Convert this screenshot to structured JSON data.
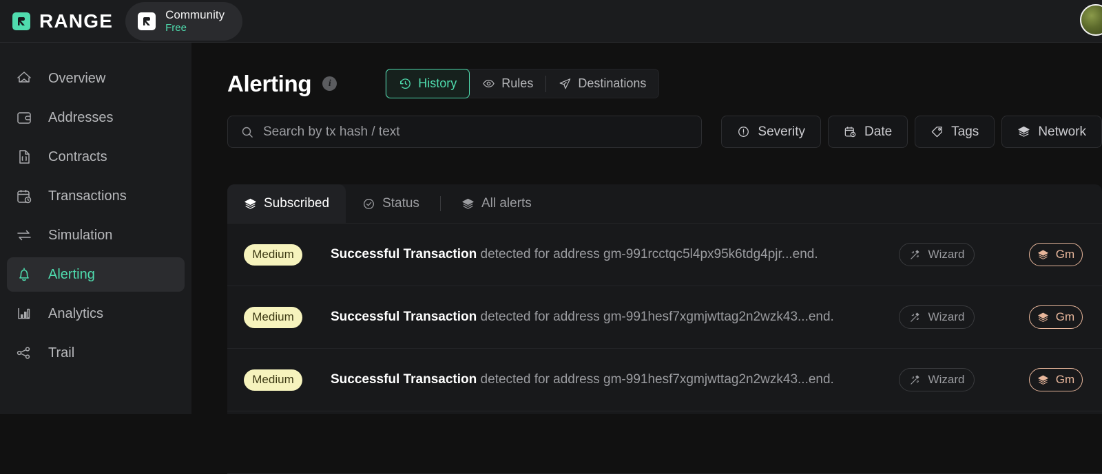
{
  "brand": {
    "name": "RANGE",
    "logo_icon": "range-logo-icon"
  },
  "plan": {
    "name": "Community",
    "tier": "Free",
    "icon": "range-badge-icon"
  },
  "account": {
    "avatar_icon": "user-avatar"
  },
  "sidebar": {
    "items": [
      {
        "label": "Overview",
        "icon": "home-icon",
        "active": false
      },
      {
        "label": "Addresses",
        "icon": "wallet-icon",
        "active": false
      },
      {
        "label": "Contracts",
        "icon": "file-code-icon",
        "active": false
      },
      {
        "label": "Transactions",
        "icon": "calendar-clock-icon",
        "active": false
      },
      {
        "label": "Simulation",
        "icon": "swap-arrows-icon",
        "active": false
      },
      {
        "label": "Alerting",
        "icon": "bell-icon",
        "active": true
      },
      {
        "label": "Analytics",
        "icon": "bar-chart-icon",
        "active": false
      },
      {
        "label": "Trail",
        "icon": "nodes-graph-icon",
        "active": false
      }
    ]
  },
  "page": {
    "title": "Alerting",
    "info_icon": "info-icon",
    "view_tabs": [
      {
        "label": "History",
        "icon": "history-clock-icon",
        "active": true
      },
      {
        "label": "Rules",
        "icon": "eye-icon",
        "active": false
      },
      {
        "label": "Destinations",
        "icon": "send-plane-icon",
        "active": false
      }
    ]
  },
  "search": {
    "placeholder": "Search by tx hash / text",
    "value": "",
    "icon": "search-icon"
  },
  "filters": [
    {
      "label": "Severity",
      "icon": "alert-circle-icon"
    },
    {
      "label": "Date",
      "icon": "calendar-clock-icon"
    },
    {
      "label": "Tags",
      "icon": "tag-icon"
    },
    {
      "label": "Network",
      "icon": "layers-icon"
    }
  ],
  "list_tabs": [
    {
      "label": "Subscribed",
      "icon": "layers-icon",
      "active": true
    },
    {
      "label": "Status",
      "icon": "check-circle-icon",
      "active": false
    },
    {
      "label": "All alerts",
      "icon": "layers-icon",
      "active": false
    }
  ],
  "alerts": [
    {
      "severity": "Medium",
      "title": "Successful Transaction",
      "detail": " detected for address gm-991rcctqc5l4px95k6tdg4pjr...end.",
      "source": "Wizard",
      "source_icon": "magic-wand-icon",
      "network": "Gm",
      "network_icon": "layers-icon"
    },
    {
      "severity": "Medium",
      "title": "Successful Transaction",
      "detail": " detected for address gm-991hesf7xgmjwttag2n2wzk43...end.",
      "source": "Wizard",
      "source_icon": "magic-wand-icon",
      "network": "Gm",
      "network_icon": "layers-icon"
    },
    {
      "severity": "Medium",
      "title": "Successful Transaction",
      "detail": " detected for address gm-991hesf7xgmjwttag2n2wzk43...end.",
      "source": "Wizard",
      "source_icon": "magic-wand-icon",
      "network": "Gm",
      "network_icon": "layers-icon"
    }
  ],
  "colors": {
    "accent": "#4fdcae",
    "severity_medium_bg": "#f6f3bd",
    "severity_medium_text": "#3d3a14",
    "network_badge": "#e7b69b",
    "app_bg": "#111111",
    "panel_bg": "#18191b",
    "sidebar_bg": "#1b1c1e"
  }
}
